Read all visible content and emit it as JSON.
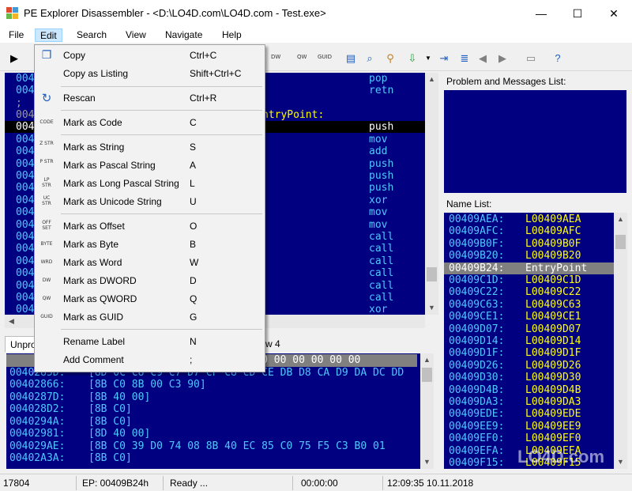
{
  "window": {
    "title": "PE Explorer Disassembler - <D:\\LO4D.com\\LO4D.com - Test.exe>",
    "minimize": "—",
    "maximize": "☐",
    "close": "✕"
  },
  "menu": [
    "File",
    "Edit",
    "Search",
    "View",
    "Navigate",
    "Help"
  ],
  "toolbar": {
    "small_labels": [
      "DWORD",
      "QWORD",
      "GUID"
    ],
    "labels": [
      "DW",
      "QW",
      "GUID"
    ]
  },
  "listing": {
    "rows": [
      {
        "addr": "00409",
        "mnem": "pop"
      },
      {
        "addr": "00409",
        "mnem": "retn"
      },
      {
        "addr": ";",
        "mnem": ""
      },
      {
        "addr": "00409",
        "mnem": ""
      },
      {
        "addr": "00409",
        "mnem": "push"
      },
      {
        "addr": "00409",
        "mnem": "mov"
      },
      {
        "addr": "00409",
        "mnem": "add"
      },
      {
        "addr": "00409",
        "mnem": "push"
      },
      {
        "addr": "00409",
        "mnem": "push"
      },
      {
        "addr": "00409",
        "mnem": "push"
      },
      {
        "addr": "00409",
        "mnem": "xor"
      },
      {
        "addr": "00409",
        "mnem": "mov"
      },
      {
        "addr": "00409",
        "mnem": "mov"
      },
      {
        "addr": "00409",
        "mnem": "call"
      },
      {
        "addr": "00409",
        "mnem": "call"
      },
      {
        "addr": "00409",
        "mnem": "call"
      },
      {
        "addr": "00409",
        "mnem": "call"
      },
      {
        "addr": "00409",
        "mnem": "call"
      },
      {
        "addr": "00409",
        "mnem": "call"
      },
      {
        "addr": "00409",
        "mnem": "xor"
      }
    ],
    "entry_label": "ntryPoint:"
  },
  "right_panel": {
    "problems_label": "Problem and Messages List:",
    "namelist_label": "Name List:",
    "names": [
      {
        "addr": "00409AEA:",
        "name": "L00409AEA"
      },
      {
        "addr": "00409AFC:",
        "name": "L00409AFC"
      },
      {
        "addr": "00409B0F:",
        "name": "L00409B0F"
      },
      {
        "addr": "00409B20:",
        "name": "L00409B20"
      },
      {
        "addr": "00409B24:",
        "name": "EntryPoint"
      },
      {
        "addr": "00409C1D:",
        "name": "L00409C1D"
      },
      {
        "addr": "00409C22:",
        "name": "L00409C22"
      },
      {
        "addr": "00409C63:",
        "name": "L00409C63"
      },
      {
        "addr": "00409CE1:",
        "name": "L00409CE1"
      },
      {
        "addr": "00409D07:",
        "name": "L00409D07"
      },
      {
        "addr": "00409D14:",
        "name": "L00409D14"
      },
      {
        "addr": "00409D1F:",
        "name": "L00409D1F"
      },
      {
        "addr": "00409D26:",
        "name": "L00409D26"
      },
      {
        "addr": "00409D30:",
        "name": "L00409D30"
      },
      {
        "addr": "00409D4B:",
        "name": "L00409D4B"
      },
      {
        "addr": "00409DA3:",
        "name": "L00409DA3"
      },
      {
        "addr": "00409EDE:",
        "name": "L00409EDE"
      },
      {
        "addr": "00409EE9:",
        "name": "L00409EE9"
      },
      {
        "addr": "00409EF0:",
        "name": "L00409EF0"
      },
      {
        "addr": "00409EFA:",
        "name": "L00409EFA"
      },
      {
        "addr": "00409F15:",
        "name": "L00409F15"
      }
    ]
  },
  "bottom_tabs": [
    "Unpro",
    "w 4"
  ],
  "hex": {
    "rows": [
      {
        "addr": "",
        "bytes": "00 00 00 00 00 00 00 00 00 00 00 00 00 00 00"
      },
      {
        "addr": "0040285D:",
        "bytes": "[8D 0C C8 C9 C7 D7 CF C8 CD CE DB D8 CA D9 DA DC DD"
      },
      {
        "addr": "00402866:",
        "bytes": "[8B C0 8B 00 C3 90]"
      },
      {
        "addr": "0040287D:",
        "bytes": "[8B 40 00]"
      },
      {
        "addr": "004028D2:",
        "bytes": "[8B C0]"
      },
      {
        "addr": "0040294A:",
        "bytes": "[8B C0]"
      },
      {
        "addr": "00402981:",
        "bytes": "[8D 40 00]"
      },
      {
        "addr": "004029AE:",
        "bytes": "[8B C0 39 D0 74 08 8B 40 EC 85 C0 75 F5 C3 B0 01"
      },
      {
        "addr": "00402A3A:",
        "bytes": "[8B C0]"
      }
    ]
  },
  "status": {
    "count": "17804",
    "ep": "EP: 00409B24h",
    "state": "Ready ...",
    "elapsed": "00:00:00",
    "datetime": "12:09:35 10.11.2018"
  },
  "edit_menu": [
    {
      "icon": "copy-icon",
      "glyph": "❐",
      "label": "Copy",
      "shortcut": "Ctrl+C"
    },
    {
      "icon": "",
      "glyph": "",
      "label": "Copy as Listing",
      "shortcut": "Shift+Ctrl+C"
    },
    {
      "sep": true
    },
    {
      "icon": "rescan-icon",
      "glyph": "↻",
      "label": "Rescan",
      "shortcut": "Ctrl+R"
    },
    {
      "sep": true
    },
    {
      "icon": "code-icon",
      "glyph": "CODE",
      "label": "Mark as Code",
      "shortcut": "C"
    },
    {
      "sep": true
    },
    {
      "icon": "string-icon",
      "glyph": "Z STR",
      "label": "Mark as String",
      "shortcut": "S"
    },
    {
      "icon": "pascal-string-icon",
      "glyph": "P STR",
      "label": "Mark as Pascal String",
      "shortcut": "A"
    },
    {
      "icon": "long-pascal-string-icon",
      "glyph": "LP STR",
      "label": "Mark as Long Pascal String",
      "shortcut": "L"
    },
    {
      "icon": "unicode-string-icon",
      "glyph": "UC STR",
      "label": "Mark as Unicode String",
      "shortcut": "U"
    },
    {
      "sep": true
    },
    {
      "icon": "offset-icon",
      "glyph": "OFF SET",
      "label": "Mark as Offset",
      "shortcut": "O"
    },
    {
      "icon": "byte-icon",
      "glyph": "BYTE",
      "label": "Mark as Byte",
      "shortcut": "B"
    },
    {
      "icon": "word-icon",
      "glyph": "WRD",
      "label": "Mark as Word",
      "shortcut": "W"
    },
    {
      "icon": "dword-icon",
      "glyph": "DW",
      "label": "Mark as DWORD",
      "shortcut": "D"
    },
    {
      "icon": "qword-icon",
      "glyph": "QW",
      "label": "Mark as QWORD",
      "shortcut": "Q"
    },
    {
      "icon": "guid-icon",
      "glyph": "GUID",
      "label": "Mark as GUID",
      "shortcut": "G"
    },
    {
      "sep": true
    },
    {
      "icon": "",
      "glyph": "",
      "label": "Rename Label",
      "shortcut": "N"
    },
    {
      "icon": "",
      "glyph": "",
      "label": "Add Comment",
      "shortcut": ";"
    }
  ],
  "watermark": "LO4D.com",
  "colors": {
    "panel_bg": "#000080",
    "addr": "#4fc8ff",
    "name": "#ffff00",
    "selection": "#000000"
  }
}
